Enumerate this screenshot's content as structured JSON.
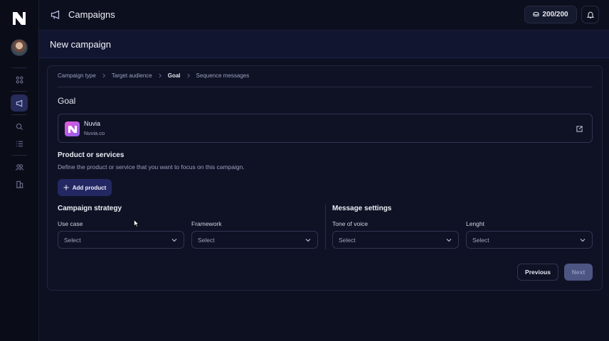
{
  "app": {
    "section_title": "Campaigns"
  },
  "header": {
    "credits": "200/200"
  },
  "page": {
    "title": "New campaign"
  },
  "breadcrumbs": [
    {
      "label": "Campaign type",
      "current": false
    },
    {
      "label": "Target audience",
      "current": false
    },
    {
      "label": "Goal",
      "current": true
    },
    {
      "label": "Sequence messages",
      "current": false
    }
  ],
  "goal": {
    "title": "Goal",
    "company_name": "Nuvia",
    "company_url": "Nuvia.co"
  },
  "products": {
    "title": "Product or services",
    "description": "Define the product or service that you want to focus on this campaign.",
    "add_button": "Add product"
  },
  "campaign_strategy": {
    "title": "Campaign strategy",
    "use_case_label": "Use case",
    "use_case_value": "Select",
    "framework_label": "Framework",
    "framework_value": "Select"
  },
  "message_settings": {
    "title": "Message settings",
    "tone_label": "Tone of voice",
    "tone_value": "Select",
    "length_label": "Lenght",
    "length_value": "Select"
  },
  "actions": {
    "previous": "Previous",
    "next": "Next"
  },
  "icons": {
    "sidebar": [
      "logo-icon",
      "dashboard-icon",
      "campaigns-icon",
      "search-icon",
      "list-icon",
      "users-icon",
      "building-icon"
    ],
    "topbar": [
      "megaphone-icon",
      "coins-icon",
      "bell-icon"
    ]
  },
  "colors": {
    "accent": "#232863",
    "active_nav": "#272c5a",
    "company_gradient": [
      "#e65ad8",
      "#8b5ff0"
    ]
  }
}
